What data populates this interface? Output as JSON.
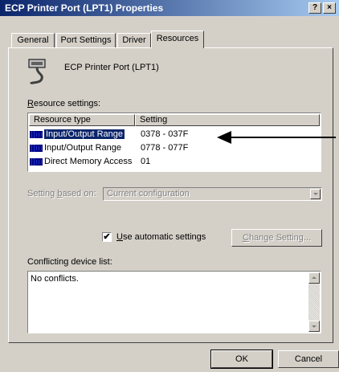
{
  "window": {
    "title": "ECP Printer Port (LPT1) Properties",
    "help_label": "?",
    "close_label": "×"
  },
  "tabs": [
    {
      "label": "General"
    },
    {
      "label": "Port Settings"
    },
    {
      "label": "Driver"
    },
    {
      "label": "Resources",
      "active": true
    }
  ],
  "device": {
    "name": "ECP Printer Port (LPT1)",
    "icon": "port-icon"
  },
  "resource_settings": {
    "label_key": "R",
    "label_rest": "esource settings:",
    "columns": [
      "Resource type",
      "Setting"
    ],
    "rows": [
      {
        "type": "Input/Output Range",
        "setting": "0378 - 037F",
        "selected": true
      },
      {
        "type": "Input/Output Range",
        "setting": "0778 - 077F"
      },
      {
        "type": "Direct Memory Access",
        "setting": "01"
      }
    ]
  },
  "setting_based_on": {
    "label_pre": "Setting ",
    "label_key": "b",
    "label_post": "ased on:",
    "value": "Current configuration"
  },
  "automatic": {
    "checked": true,
    "check_mark": "✔",
    "label_key": "U",
    "label_rest": "se automatic settings"
  },
  "change_setting": {
    "label_key": "C",
    "label_rest": "hange Setting..."
  },
  "conflicts": {
    "label": "Conflicting device list:",
    "text": "No conflicts."
  },
  "buttons": {
    "ok": "OK",
    "cancel": "Cancel"
  },
  "colors": {
    "selection": "#0a246a",
    "titlebar_start": "#0a246a",
    "titlebar_end": "#a6caf0",
    "face": "#d4d0c8"
  }
}
